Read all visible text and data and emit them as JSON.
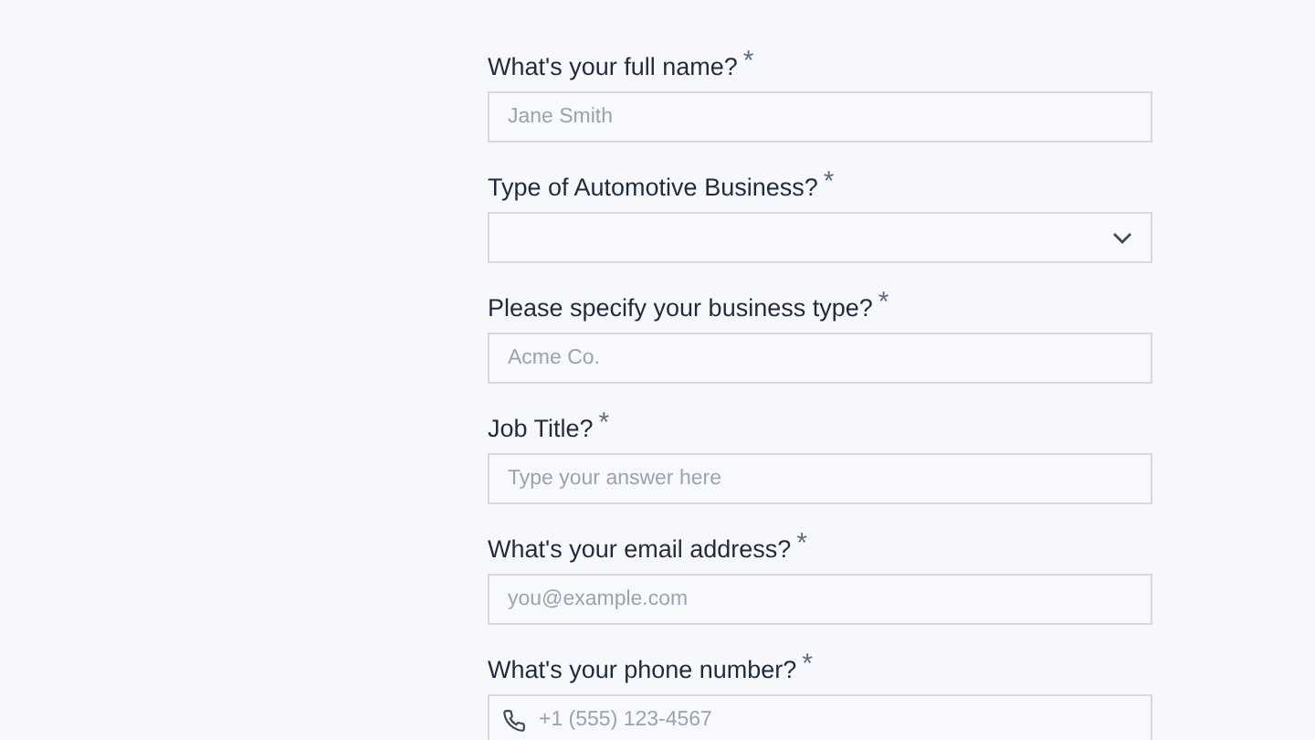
{
  "fields": [
    {
      "kind": "text",
      "label": "What's your full name?",
      "required_mark": "*",
      "placeholder": "Jane Smith"
    },
    {
      "kind": "select",
      "label": "Type of Automotive Business?",
      "required_mark": "*"
    },
    {
      "kind": "text",
      "label": "Please specify your business type?",
      "required_mark": "*",
      "placeholder": "Acme Co."
    },
    {
      "kind": "text",
      "label": "Job Title?",
      "required_mark": "*",
      "placeholder": "Type your answer here"
    },
    {
      "kind": "text",
      "label": "What's your email address?",
      "required_mark": "*",
      "placeholder": "you@example.com"
    },
    {
      "kind": "phone",
      "label": "What's your phone number?",
      "required_mark": "*",
      "placeholder": "+1 (555) 123-4567"
    }
  ]
}
